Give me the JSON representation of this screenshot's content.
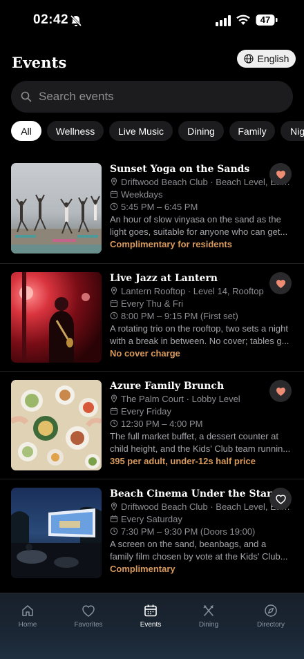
{
  "status_bar": {
    "time": "02:42",
    "battery": "47"
  },
  "header": {
    "title": "Events",
    "language": "English"
  },
  "search": {
    "placeholder": "Search events"
  },
  "filters": [
    "All",
    "Wellness",
    "Live Music",
    "Dining",
    "Family",
    "Nig"
  ],
  "active_filter": "All",
  "events": [
    {
      "title": "Sunset Yoga on the Sands",
      "location": "Driftwood Beach Club · Beach Level, Eas...",
      "schedule": "Weekdays",
      "time": "5:45 PM – 6:45 PM",
      "description_line1": "An hour of slow vinyasa on the sand as the",
      "description_line2": "light goes, suitable for anyone who can get...",
      "price": "Complimentary for residents",
      "favorited": true
    },
    {
      "title": "Live Jazz at Lantern",
      "location": "Lantern Rooftop · Level 14, Rooftop",
      "schedule": "Every Thu & Fri",
      "time": "8:00 PM – 9:15 PM (First set)",
      "description_line1": "A rotating trio on the rooftop, two sets a night",
      "description_line2": "with a break in between. No cover; tables g...",
      "price": "No cover charge",
      "favorited": true
    },
    {
      "title": "Azure Family Brunch",
      "location": "The Palm Court · Lobby Level",
      "schedule": "Every Friday",
      "time": "12:30 PM – 4:00 PM",
      "description_line1": "The full market buffet, a dessert counter at",
      "description_line2": "child height, and the Kids' Club team runnin...",
      "price": "395 per adult, under-12s half price",
      "favorited": true
    },
    {
      "title": "Beach Cinema Under the Stars",
      "location": "Driftwood Beach Club · Beach Level, Eas...",
      "schedule": "Every Saturday",
      "time": "7:30 PM – 9:30 PM (Doors 19:00)",
      "description_line1": "A screen on the sand, beanbags, and a",
      "description_line2": "family film chosen by vote at the Kids' Club...",
      "price": "Complimentary",
      "favorited": false
    }
  ],
  "tabs": [
    {
      "label": "Home",
      "icon": "home-icon"
    },
    {
      "label": "Favorites",
      "icon": "heart-icon"
    },
    {
      "label": "Events",
      "icon": "calendar-icon",
      "active": true
    },
    {
      "label": "Dining",
      "icon": "utensils-icon"
    },
    {
      "label": "Directory",
      "icon": "compass-icon"
    }
  ],
  "colors": {
    "accent_price": "#d99a5c",
    "heart": "#ee8c74",
    "background": "#000000"
  }
}
